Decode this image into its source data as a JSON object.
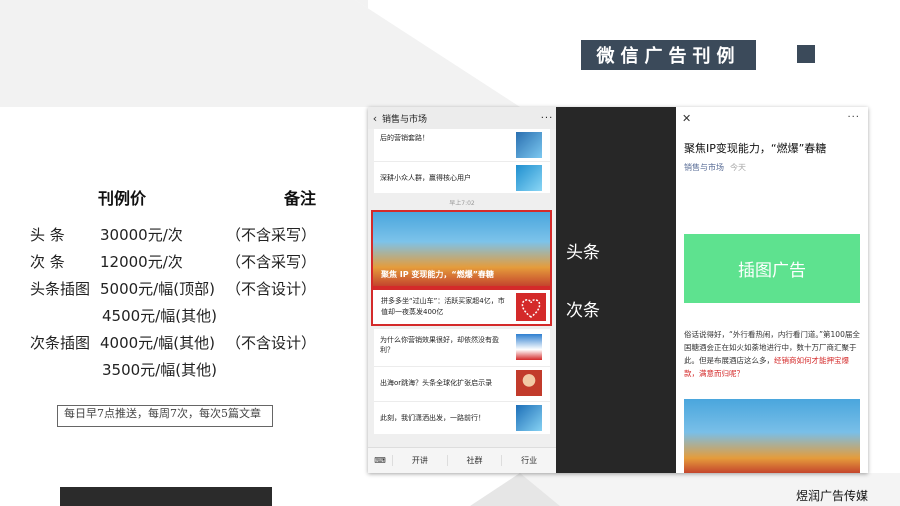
{
  "slide": {
    "title": "微信广告刊例",
    "price_header": "刊例价",
    "note_header": "备注",
    "rows": [
      {
        "name": "头  条",
        "price": "30000元/次",
        "note": "（不含采写）"
      },
      {
        "name": "次  条",
        "price": "12000元/次",
        "note": "（不含采写）"
      },
      {
        "name": "头条插图",
        "price": "5000元/幅(顶部)",
        "note": "（不含设计）"
      },
      {
        "name": "",
        "price": "4500元/幅(其他)",
        "note": ""
      },
      {
        "name": "次条插图",
        "price": "4000元/幅(其他)",
        "note": "（不含设计）"
      },
      {
        "name": "",
        "price": "3500元/幅(其他)",
        "note": ""
      }
    ],
    "push_note": "每日早7点推送，每周7次，每次5篇文章",
    "brand": "煜润广告传媒"
  },
  "wechat_list": {
    "header_title": "销售与市场",
    "top_items": [
      "后的营销套路！",
      "深耕小众人群，赢得核心用户"
    ],
    "timestamp": "早上7:02",
    "hero_caption": "聚焦 IP 变现能力，“燃爆”春糖",
    "second_item": "拼多多坐“过山车”：活跃买家超4亿，市值却一夜蒸发400亿",
    "more_items": [
      "为什么你营销效果很好，却依然没有盈利？",
      "出海or跳海？头条全球化扩张启示录",
      "此刻，我们潇洒出发，一路前行！"
    ],
    "footer_menus": [
      "开讲",
      "社群",
      "行业"
    ]
  },
  "labels": {
    "headline": "头条",
    "secondary": "次条"
  },
  "article": {
    "title": "聚焦IP变现能力，“燃爆”春糖",
    "account": "销售与市场",
    "date": "今天",
    "ad_box": "插图广告",
    "body": "俗话说得好，“外行看热闹，内行看门道。”第100届全国糖酒会正在如火如荼地进行中，数十万厂商汇聚于此。但是布展酒店这么多，",
    "body_red": "经销商如何才能押宝爆款，满意而归呢？"
  },
  "colors": {
    "title_bg": "#3b4a5a",
    "highlight": "#d42a2a",
    "ad_green": "#5ee28f",
    "dark_panel": "#272727"
  }
}
